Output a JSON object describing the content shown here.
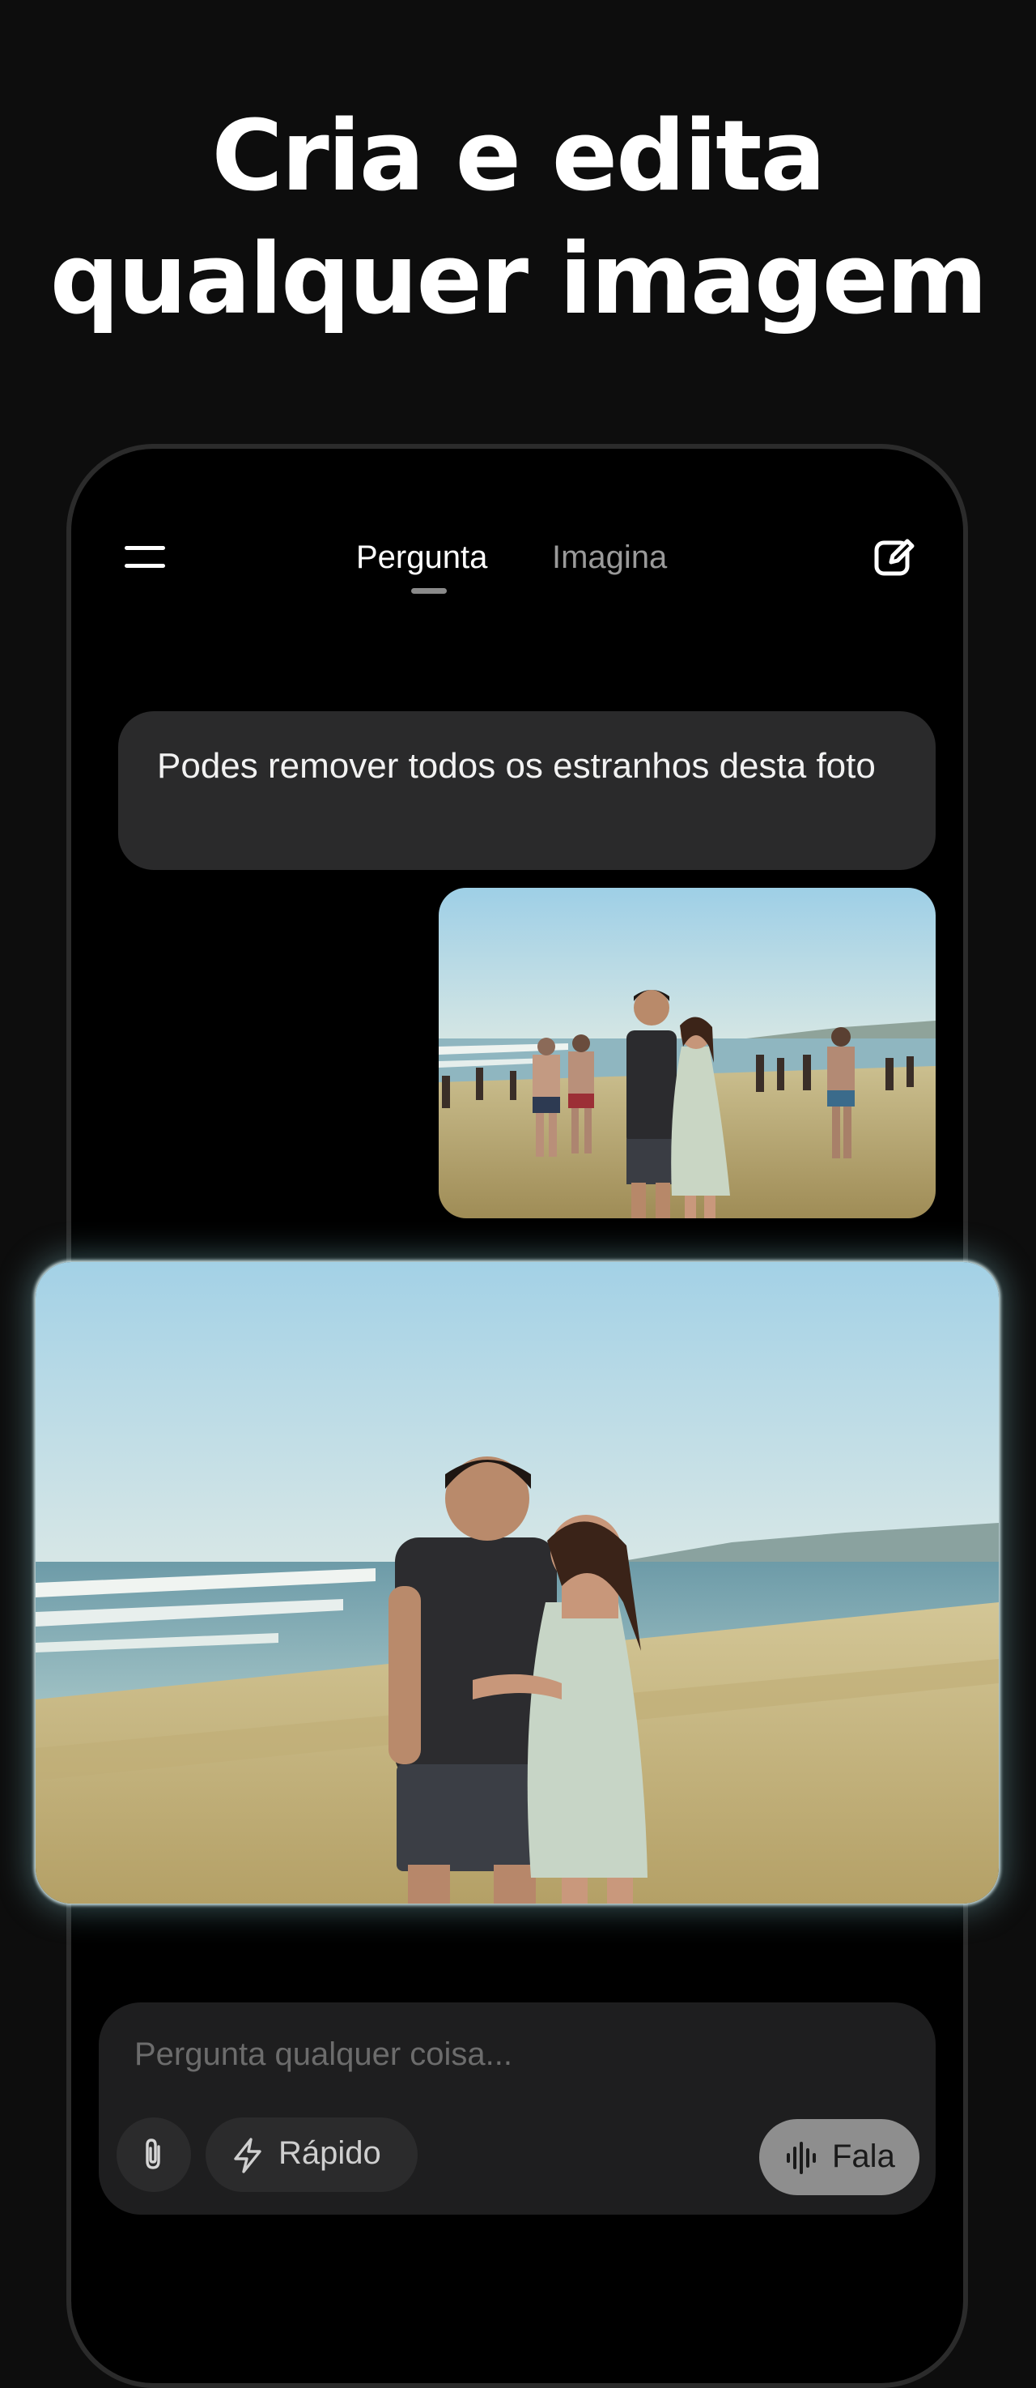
{
  "headline": {
    "line1": "Cria e edita",
    "line2": "qualquer imagem"
  },
  "topbar": {
    "menu_icon": "hamburger-menu-icon",
    "tabs": [
      {
        "label": "Pergunta",
        "active": true
      },
      {
        "label": "Imagina",
        "active": false
      }
    ],
    "edit_icon": "new-chat-edit-icon"
  },
  "conversation": {
    "user_message": "Podes remover todos os estranhos desta foto",
    "attached_image": "beach couple photo with strangers in background",
    "result_image": "beach couple photo with strangers removed"
  },
  "composer": {
    "placeholder": "Pergunta qualquer coisa...",
    "attach_icon": "paperclip-icon",
    "mode_icon": "lightning-icon",
    "mode_label": "Rápido",
    "voice_icon": "waveform-icon",
    "voice_label": "Fala"
  },
  "colors": {
    "background": "#0d0d0d",
    "phone_screen": "#000000",
    "bubble": "#2a2a2b",
    "composer": "#1e1e1f",
    "speak_button": "#8e8e8e",
    "result_glow": "#d8eef0"
  }
}
